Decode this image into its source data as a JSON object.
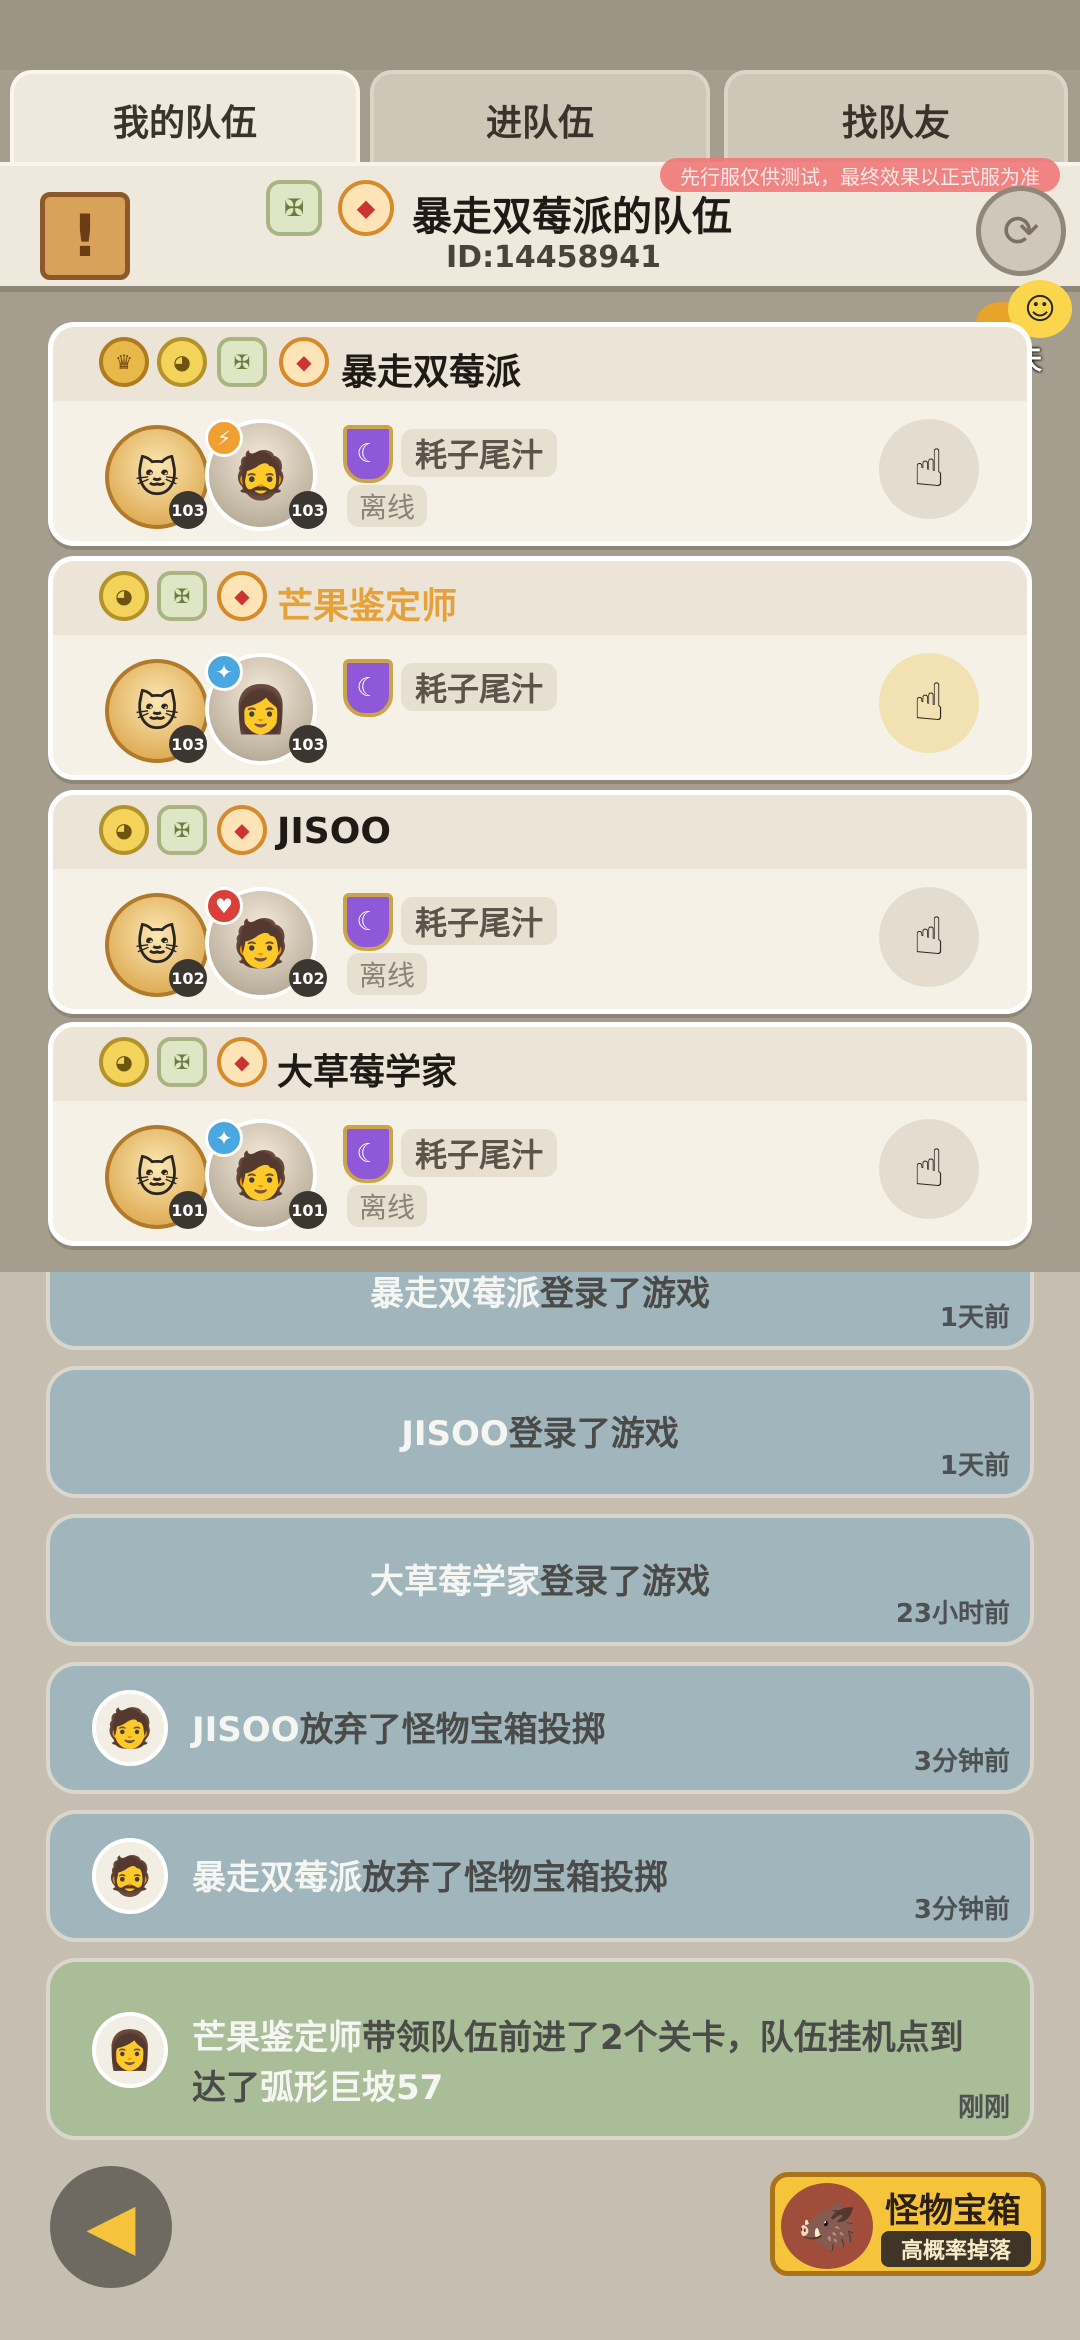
{
  "tabs": [
    {
      "label": "我的队伍",
      "active": true
    },
    {
      "label": "进队伍",
      "active": false
    },
    {
      "label": "找队友",
      "active": false
    }
  ],
  "header": {
    "title": "暴走双莓派的队伍",
    "id": "ID:14458941",
    "test_notice": "先行服仅供测试，最终效果以正式服为准"
  },
  "chat": {
    "label": "聊天"
  },
  "members": [
    {
      "name": "暴走双莓派",
      "name_color": "#1f1a15",
      "level_a": "103",
      "level_b": "103",
      "guild": "耗子尾汁",
      "status": "离线",
      "class_color": "#f0a030",
      "avatar": "🧔"
    },
    {
      "name": "芒果鉴定师",
      "name_color": "#e6a23a",
      "level_a": "103",
      "level_b": "103",
      "guild": "耗子尾汁",
      "status": "",
      "class_color": "#4aa7e0",
      "avatar": "👩"
    },
    {
      "name": "JISOO",
      "name_color": "#1f1a15",
      "level_a": "102",
      "level_b": "102",
      "guild": "耗子尾汁",
      "status": "离线",
      "class_color": "#d9403a",
      "avatar": "🧑"
    },
    {
      "name": "大草莓学家",
      "name_color": "#1f1a15",
      "level_a": "101",
      "level_b": "101",
      "guild": "耗子尾汁",
      "status": "离线",
      "class_color": "#4aa7e0",
      "avatar": "🧑"
    }
  ],
  "logs": [
    {
      "highlight": "暴走双莓派",
      "text": "登录了游戏",
      "time": "1天前"
    },
    {
      "highlight": "JISOO",
      "text": "登录了游戏",
      "time": "1天前"
    },
    {
      "highlight": "大草莓学家",
      "text": "登录了游戏",
      "time": "23小时前"
    },
    {
      "highlight": "JISOO",
      "text": "放弃了怪物宝箱投掷",
      "time": "3分钟前"
    },
    {
      "highlight": "暴走双莓派",
      "text": "放弃了怪物宝箱投掷",
      "time": "3分钟前"
    },
    {
      "highlight": "芒果鉴定师",
      "text": "带领队伍前进了2个关卡，队伍挂机点到",
      "text2_prefix": "达了",
      "text2_highlight": "弧形巨坡57",
      "time": "刚刚"
    }
  ],
  "chest": {
    "title": "怪物宝箱",
    "subtitle": "高概率掉落"
  },
  "icons": {
    "back": "back-arrow-icon",
    "switch": "swap-icon",
    "notice": "notice-board-icon"
  }
}
